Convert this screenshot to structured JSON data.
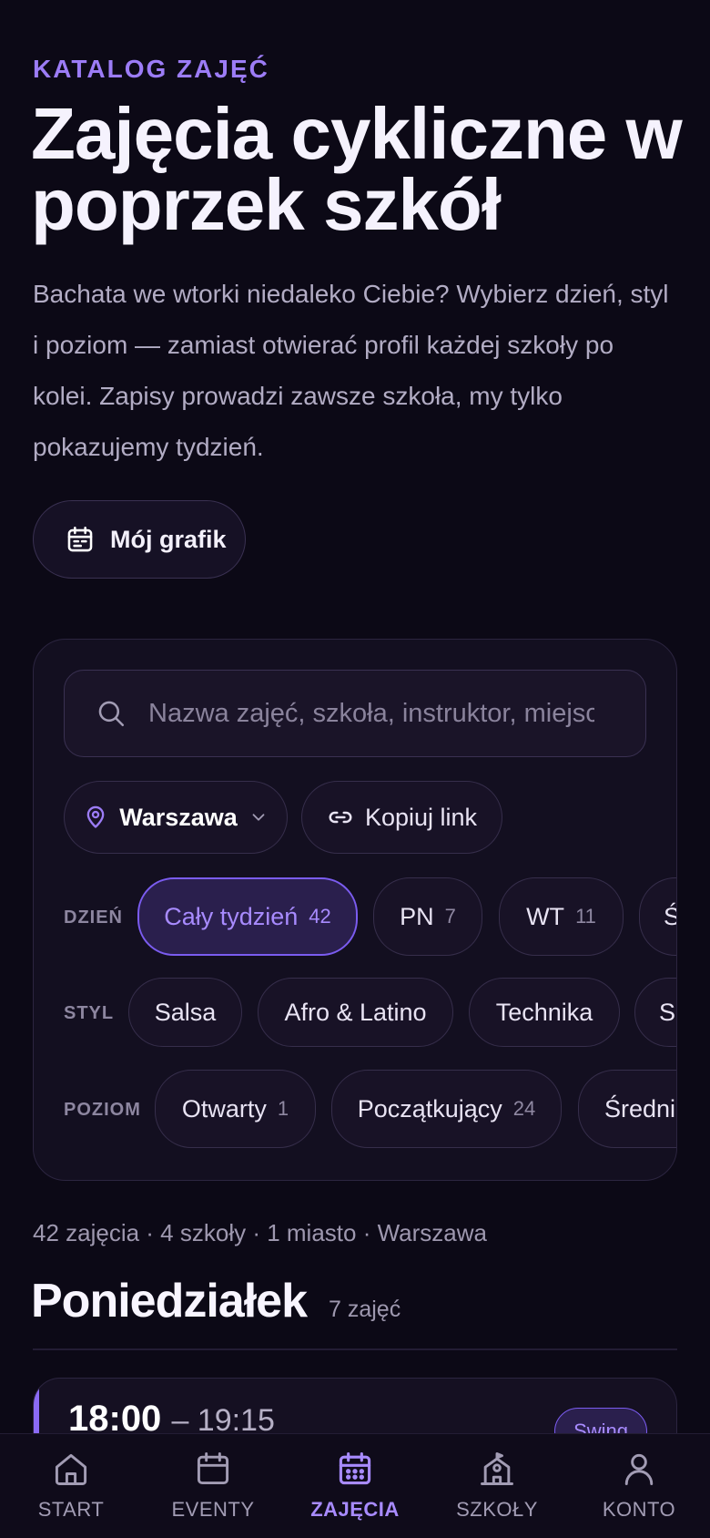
{
  "header": {
    "eyebrow": "KATALOG ZAJĘĆ",
    "title": "Zajęcia cykliczne w poprzek szkół",
    "lead": "Bachata we wtorki niedaleko Ciebie? Wybierz dzień, styl i poziom — zamiast otwierać profil każdej szkoły po kolei. Zapisy prowadzi zawsze szkoła, my tylko pokazujemy tydzień."
  },
  "schedule_button": {
    "label": "Mój grafik",
    "icon": "calendar-icon"
  },
  "search": {
    "placeholder": "Nazwa zajęć, szkoła, instruktor, miejsce",
    "value": ""
  },
  "location": {
    "city": "Warszawa",
    "icon": "map-pin-icon"
  },
  "copy_link": {
    "label": "Kopiuj link",
    "icon": "link-icon"
  },
  "filters": {
    "day_label": "DZIEŃ",
    "days": [
      {
        "label": "Cały tydzień",
        "count": "42",
        "active": true
      },
      {
        "label": "PN",
        "count": "7"
      },
      {
        "label": "WT",
        "count": "11"
      },
      {
        "label": "Ś",
        "count": ""
      }
    ],
    "style_label": "STYL",
    "styles": [
      {
        "label": "Salsa"
      },
      {
        "label": "Afro & Latino"
      },
      {
        "label": "Technika"
      },
      {
        "label": "S"
      }
    ],
    "level_label": "POZIOM",
    "levels": [
      {
        "label": "Otwarty",
        "count": "1"
      },
      {
        "label": "Początkujący",
        "count": "24"
      },
      {
        "label": "Średni",
        "count": ""
      }
    ]
  },
  "results": {
    "summary": "42 zajęcia · 4 szkoły · 1 miasto · Warszawa"
  },
  "day_section": {
    "day": "Poniedziałek",
    "count": "7 zajęć",
    "first_class": {
      "start": "18:00",
      "end": "– 19:15",
      "badge": "Swing"
    }
  },
  "tabbar": [
    {
      "label": "START",
      "icon": "home-icon"
    },
    {
      "label": "EVENTY",
      "icon": "calendar-icon"
    },
    {
      "label": "ZAJĘCIA",
      "icon": "calendar-grid-icon",
      "active": true
    },
    {
      "label": "SZKOŁY",
      "icon": "school-icon"
    },
    {
      "label": "KONTO",
      "icon": "user-icon"
    }
  ],
  "colors": {
    "accent": "#9c7cf6",
    "background": "#0c0916",
    "active_chip": "#2a1f4d"
  }
}
